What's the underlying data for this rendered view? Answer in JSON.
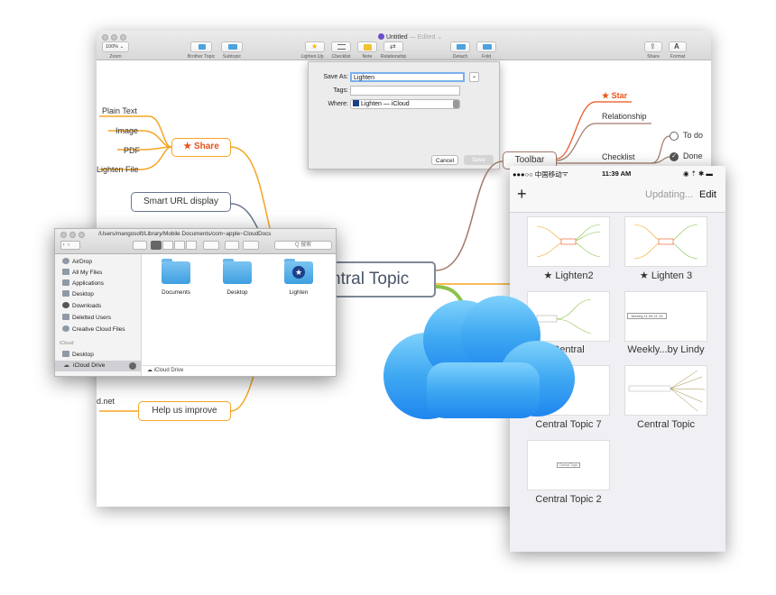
{
  "main_window": {
    "title": "Untitled",
    "title_suffix": "— Edited ⌄",
    "zoom_value": "100% ⌄",
    "toolbar_labels": {
      "zoom": "Zoom",
      "brother_topic": "Brother Topic",
      "subtopic": "Subtopic",
      "lighten_up": "Lighten Up",
      "checklist": "Checklist",
      "note": "Note",
      "relationship": "Relationship",
      "detach": "Detach",
      "fold": "Fold",
      "share": "Share",
      "format": "Format"
    }
  },
  "save_dialog": {
    "save_as_label": "Save As:",
    "save_as_value": "Lighten",
    "tags_label": "Tags:",
    "tags_value": "",
    "where_label": "Where:",
    "where_value": "Lighten — iCloud",
    "cancel_label": "Cancel",
    "save_label": "Save"
  },
  "mindmap": {
    "central_topic": "ntral Topic",
    "share": "★ Share",
    "plain_text": "Plain Text",
    "image": "Image",
    "pdf": "PDF",
    "lighten_file": "Lighten File",
    "smart_url": "Smart URL display",
    "toolbar": "Toolbar",
    "star": "★ Star",
    "relationship": "Relationship",
    "checklist": "Checklist",
    "to_do": "To do",
    "done": "Done",
    "help": "Help us improve",
    "d_net": "d.net"
  },
  "finder": {
    "path": "/Users/mangosoft/Library/Mobile Documents/com~apple~CloudDocs",
    "search_placeholder": "Q 搜索",
    "sidebar_items": [
      "AirDrop",
      "All My Files",
      "Applications",
      "Desktop",
      "Downloads",
      "Deletted Users",
      "Creative Cloud Files"
    ],
    "icloud_heading": "iCloud",
    "icloud_items": [
      "Desktop",
      "iCloud Drive"
    ],
    "folders": [
      "Documents",
      "Desktop",
      "Lighten"
    ],
    "status_path": "iCloud Drive"
  },
  "phone": {
    "carrier": "●●●○○ 中国移动 ",
    "time": "11:39 AM",
    "status_right": "◉ ⇡ ✱ ▬",
    "add_label": "+",
    "updating": "Updating...",
    "edit": "Edit",
    "documents": [
      "★ Lighten2",
      "★ Lighten 3",
      "Central",
      "Weekly...by Lindy",
      "Central Topic 7",
      "Central Topic",
      "Central Topic 2"
    ],
    "thumb_texts": [
      "Weekly 11.09-11.15",
      "Central Topic"
    ]
  },
  "colors": {
    "orange": "#f5a623",
    "red": "#e8521a",
    "brown": "#a0786a",
    "slate": "#6a7690",
    "green": "#8bc34a",
    "cloud": "#3ea8f2"
  }
}
